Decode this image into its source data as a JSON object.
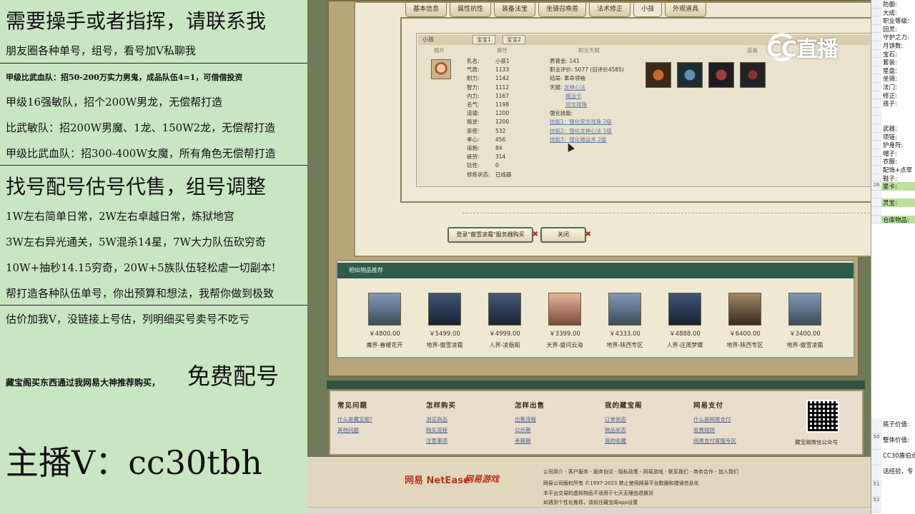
{
  "left_overlay": {
    "lines": [
      "需要操手或者指挥，请联系我",
      "朋友圈各种单号，组号，看号加V私聊我",
      "甲级比武血队：招50-200万实力男鬼，成品队伍4=1，可借借投资",
      "甲级16强敏队，招个200W男龙，无偿帮打造",
      "比武敏队：招200W男魔、1龙、150W2龙，无偿帮打造",
      "甲级比武血队：招300-400W女魔，所有角色无偿帮打造",
      "找号配号估号代售，组号调整",
      "1W左右简单日常，2W左右卓越日常，炼狱地宫",
      "3W左右异光通关，5W混杀14星，7W大力队伍砍穷奇",
      "10W+抽秒14.15穷奇，20W+5族队伍轻松虐一切副本!",
      "帮打造各种队伍单号，你出预算和想法，我帮你做到极致",
      "估价加我V，没链接上号估，列明细买号卖号不吃亏",
      "藏宝阁买东西通过我网易大神推荐购买，",
      "免费配号",
      "主播V：cc30tbh"
    ]
  },
  "tabs": [
    "基本信息",
    "属性抗性",
    "装备法宝",
    "坐骑召唤兽",
    "法术修正",
    "小孩",
    "外观道具"
  ],
  "active_tab": "小孩",
  "pet_panel": {
    "title": "小孩",
    "subtabs": [
      "宝宝1",
      "宝宝2"
    ],
    "col_heads": [
      "图片",
      "属性",
      "职业天赋",
      "装备"
    ],
    "attrs": [
      {
        "k": "乳名:",
        "v": "小孩1"
      },
      {
        "k": "气质:",
        "v": "1133"
      },
      {
        "k": "耐力:",
        "v": "1142"
      },
      {
        "k": "智力:",
        "v": "1112"
      },
      {
        "k": "内力:",
        "v": "1167"
      },
      {
        "k": "名气:",
        "v": "1198"
      },
      {
        "k": "道德:",
        "v": "1200"
      },
      {
        "k": "叛逆:",
        "v": "1200"
      },
      {
        "k": "亲密:",
        "v": "532"
      },
      {
        "k": "孝心:",
        "v": "456"
      },
      {
        "k": "道抱:",
        "v": "84"
      },
      {
        "k": "疲劳:",
        "v": "314"
      },
      {
        "k": "玩性:",
        "v": "0"
      },
      {
        "k": "修炼状态:",
        "v": "已成器"
      }
    ],
    "career": {
      "yang_yu_jin": "养育金: 141",
      "score": "职业评价: 5077 (旧评价4585)",
      "result": "结局: 革命领袖",
      "tianfu_label": "天赋:",
      "tianfu": [
        "龙神心法",
        "福运卡",
        "双龙戏珠"
      ],
      "skill_label": "强化技能:",
      "skills": [
        "技能1：强化双龙戏珠 2级",
        "技能2：强化龙神心法 1级",
        "技能3：强化福运术 2级"
      ]
    }
  },
  "buttons": {
    "login": "登录\"傲雪凌霜\"服务器购买",
    "close": "关闭"
  },
  "similar": {
    "title": "相似物品推荐",
    "items": [
      {
        "price": "￥4800.00",
        "server": "魔界-春暖花开"
      },
      {
        "price": "￥5499.00",
        "server": "地界-傲雪凌霜"
      },
      {
        "price": "￥4999.00",
        "server": "人界-凌烟阁"
      },
      {
        "price": "￥3399.00",
        "server": "天界-盛问云海"
      },
      {
        "price": "￥4333.00",
        "server": "地界-陕西专区"
      },
      {
        "price": "￥4888.00",
        "server": "人界-庄周梦蝶"
      },
      {
        "price": "￥6400.00",
        "server": "地界-陕西专区"
      },
      {
        "price": "￥3400.00",
        "server": "地界-傲雪凌霜"
      }
    ]
  },
  "footer": {
    "cols": [
      {
        "head": "常见问题",
        "items": [
          "什么是藏宝阁?",
          "其他问题"
        ]
      },
      {
        "head": "怎样购买",
        "items": [
          "浏览商品",
          "购买流程",
          "注意事项"
        ]
      },
      {
        "head": "怎样出售",
        "items": [
          "出售流程",
          "公示期",
          "考察期"
        ]
      },
      {
        "head": "我的藏宝阁",
        "items": [
          "订单状态",
          "物品状态",
          "我的收藏"
        ]
      },
      {
        "head": "网易支付",
        "items": [
          "什么是网易支付",
          "收费规则",
          "网易支付客服专区"
        ]
      }
    ],
    "qr_caption": "藏宝阁微信公众号"
  },
  "bottom": {
    "logo1": "网易 NetEase",
    "logo2": "网易游戏",
    "links": "公司简介 - 客户服务 - 服务协议 - 隐私政策 - 网易游戏 - 联系我们 - 商务合作 - 加入我们",
    "copyright": "网易公司版权所有 ©1997-2023  禁止使用网易平台数据和错误信息化",
    "notice1": "本平台交易的虚拟物品不适用于七天无理由退换货",
    "notice2": "如遇到个性化推荐，请前往藏宝阁app设置"
  },
  "watermark": "CC直播",
  "sheet": {
    "rows": [
      {
        "n": "",
        "t": "防御:",
        "g": false
      },
      {
        "n": "",
        "t": "大成:",
        "g": false
      },
      {
        "n": "",
        "t": "职业等级:",
        "g": false
      },
      {
        "n": "",
        "t": "回灵:",
        "g": false
      },
      {
        "n": "",
        "t": "守护之力:",
        "g": false
      },
      {
        "n": "",
        "t": "月饼数:",
        "g": false
      },
      {
        "n": "",
        "t": "宝石:",
        "g": false
      },
      {
        "n": "",
        "t": "套装:",
        "g": false
      },
      {
        "n": "",
        "t": "星盘:",
        "g": false
      },
      {
        "n": "",
        "t": "坐骑:",
        "g": false
      },
      {
        "n": "",
        "t": "法门:",
        "g": false
      },
      {
        "n": "",
        "t": "修正:",
        "g": false
      },
      {
        "n": "",
        "t": "孩子:",
        "g": false
      },
      {
        "n": "",
        "t": "",
        "g": false
      },
      {
        "n": "",
        "t": "",
        "g": false
      },
      {
        "n": "",
        "t": "武器:",
        "g": false
      },
      {
        "n": "",
        "t": "项链:",
        "g": false
      },
      {
        "n": "",
        "t": "护身符:",
        "g": false
      },
      {
        "n": "",
        "t": "帽子:",
        "g": false
      },
      {
        "n": "",
        "t": "衣服:",
        "g": false
      },
      {
        "n": "",
        "t": "配饰+点翠",
        "g": false
      },
      {
        "n": "",
        "t": "鞋子:",
        "g": false
      },
      {
        "n": "26",
        "t": "星卡:",
        "g": true
      },
      {
        "n": "",
        "t": "",
        "g": false
      },
      {
        "n": "",
        "t": "灵宝:",
        "g": true
      },
      {
        "n": "",
        "t": "",
        "g": false
      },
      {
        "n": "",
        "t": "仓库物品:",
        "g": true
      }
    ],
    "bottom_rows": [
      {
        "n": "",
        "t": "底子价值:"
      },
      {
        "n": "50",
        "t": "整体价值:"
      },
      {
        "n": "",
        "t": "CC30盾伯点"
      },
      {
        "n": "",
        "t": "话经验，专"
      },
      {
        "n": "51",
        "t": ""
      },
      {
        "n": "52",
        "t": ""
      }
    ]
  }
}
